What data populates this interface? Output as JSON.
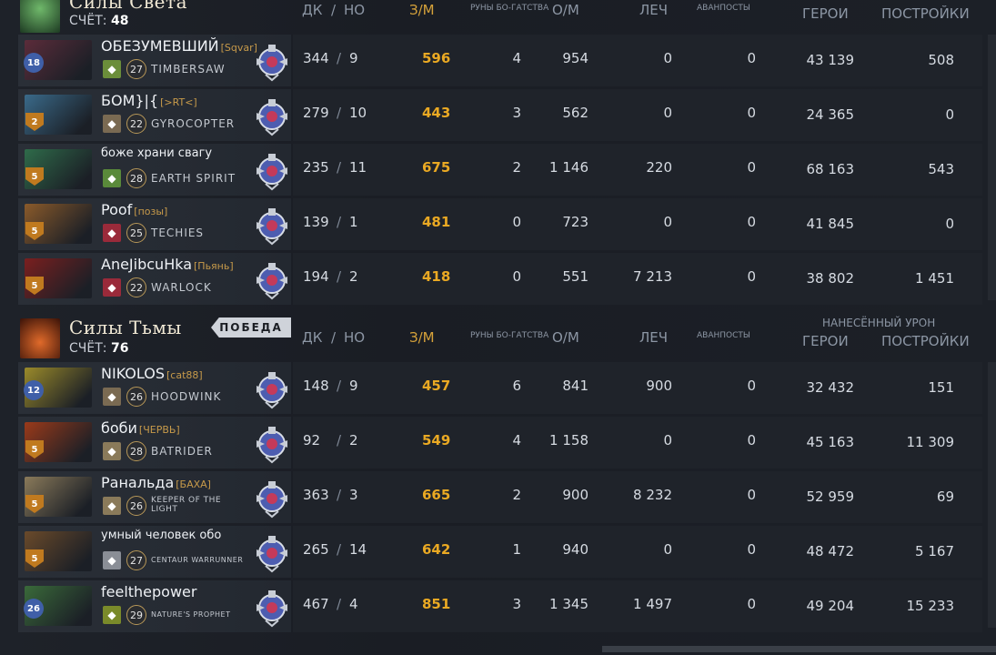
{
  "teams": [
    {
      "name": "Силы Света",
      "score_label": "СЧЁТ:",
      "score": "48",
      "colors": {
        "accent": "#66a35a"
      },
      "headers": {
        "kda_k": "ДК",
        "kda_sep": "/",
        "kda_d": "НО",
        "nw": "З/М",
        "runes": "РУНЫ БО-ГАТСТВА",
        "xpm": "О/М",
        "heal": "ЛЕЧ",
        "outposts": "АВАНПОСТЫ",
        "heroes": "ГЕРОИ",
        "buildings": "ПОСТРОЙКИ",
        "damage_group": ""
      },
      "players": [
        {
          "name": "ОБЕЗУМЕВШИЙ",
          "guild": "[Sqvar]",
          "hero": "TIMBERSAW",
          "hero_level": "18",
          "player_level": "27",
          "k": "344",
          "d": "9",
          "nw": "596",
          "runes": "4",
          "xpm": "954",
          "heal": "0",
          "outposts": "0",
          "hero_dmg": "43 139",
          "bld_dmg": "508",
          "hero_color": "#5b2c3a",
          "talent_color": "#6b8e3a",
          "talent_icon": "tree-icon"
        },
        {
          "name": "БОМ}|{",
          "guild": "[>RT<]",
          "hero": "GYROCOPTER",
          "hero_level": "2",
          "player_level": "22",
          "k": "279",
          "d": "10",
          "nw": "443",
          "runes": "3",
          "xpm": "562",
          "heal": "0",
          "outposts": "0",
          "hero_dmg": "24 365",
          "bld_dmg": "0",
          "hero_color": "#3a6a8a",
          "talent_color": "#7a6a52",
          "talent_icon": "wing-icon"
        },
        {
          "name": "боже храни свагу",
          "guild": "",
          "hero": "EARTH SPIRIT",
          "hero_level": "5",
          "player_level": "28",
          "k": "235",
          "d": "11",
          "nw": "675",
          "runes": "2",
          "xpm": "1 146",
          "heal": "220",
          "outposts": "0",
          "hero_dmg": "68 163",
          "bld_dmg": "543",
          "hero_color": "#2f6b4a",
          "talent_color": "#5a8a3a",
          "talent_icon": "leaf-icon"
        },
        {
          "name": "Poof",
          "guild": "[позы]",
          "hero": "TECHIES",
          "hero_level": "5",
          "player_level": "25",
          "k": "139",
          "d": "1",
          "nw": "481",
          "runes": "0",
          "xpm": "723",
          "heal": "0",
          "outposts": "0",
          "hero_dmg": "41 845",
          "bld_dmg": "0",
          "hero_color": "#8a5a2a",
          "talent_color": "#9a2a3a",
          "talent_icon": "claw-icon"
        },
        {
          "name": "AneJibcuHka",
          "guild": "[Пьянь]",
          "hero": "WARLOCK",
          "hero_level": "5",
          "player_level": "22",
          "k": "194",
          "d": "2",
          "nw": "418",
          "runes": "0",
          "xpm": "551",
          "heal": "7 213",
          "outposts": "0",
          "hero_dmg": "38 802",
          "bld_dmg": "1 451",
          "hero_color": "#7a1f1f",
          "talent_color": "#9a2a3a",
          "talent_icon": "castle-icon"
        }
      ]
    },
    {
      "name": "Силы Тьмы",
      "score_label": "СЧЁТ:",
      "score": "76",
      "victory": "ПОБЕДА",
      "colors": {
        "accent": "#b5481f"
      },
      "headers": {
        "kda_k": "ДК",
        "kda_sep": "/",
        "kda_d": "НО",
        "nw": "З/М",
        "runes": "РУНЫ БО-ГАТСТВА",
        "xpm": "О/М",
        "heal": "ЛЕЧ",
        "outposts": "АВАНПОСТЫ",
        "heroes": "ГЕРОИ",
        "buildings": "ПОСТРОЙКИ",
        "damage_group": "НАНЕСЁННЫЙ УРОН"
      },
      "players": [
        {
          "name": "NIKOLOS",
          "guild": "[cat88]",
          "hero": "HOODWINK",
          "hero_level": "12",
          "player_level": "26",
          "k": "148",
          "d": "9",
          "nw": "457",
          "runes": "6",
          "xpm": "841",
          "heal": "900",
          "outposts": "0",
          "hero_dmg": "32 432",
          "bld_dmg": "151",
          "hero_color": "#9a8a2a",
          "talent_color": "#7a6a52",
          "talent_icon": "hourglass-icon"
        },
        {
          "name": "боби",
          "guild": "[ЧЕРВЬ]",
          "hero": "BATRIDER",
          "hero_level": "5",
          "player_level": "28",
          "k": "92",
          "d": "2",
          "nw": "549",
          "runes": "4",
          "xpm": "1 158",
          "heal": "0",
          "outposts": "0",
          "hero_dmg": "45 163",
          "bld_dmg": "11 309",
          "hero_color": "#9a3a1a",
          "talent_color": "#8a7a5a",
          "talent_icon": "sword-icon"
        },
        {
          "name": "Ранальда",
          "guild": "[БАХА]",
          "hero": "KEEPER OF THE LIGHT",
          "hero_level": "5",
          "player_level": "26",
          "k": "363",
          "d": "3",
          "nw": "665",
          "runes": "2",
          "xpm": "900",
          "heal": "8 232",
          "outposts": "0",
          "hero_dmg": "52 959",
          "bld_dmg": "69",
          "hero_color": "#8a7a5a",
          "talent_color": "#8a7a5a",
          "talent_icon": "boot-icon"
        },
        {
          "name": "умный человек обо",
          "guild": "",
          "hero": "CENTAUR WARRUNNER",
          "hero_level": "5",
          "player_level": "27",
          "k": "265",
          "d": "14",
          "nw": "642",
          "runes": "1",
          "xpm": "940",
          "heal": "0",
          "outposts": "0",
          "hero_dmg": "48 472",
          "bld_dmg": "5 167",
          "hero_color": "#6a4a2a",
          "talent_color": "#8a8e96",
          "talent_icon": "wing-icon"
        },
        {
          "name": "feelthepower",
          "guild": "",
          "hero": "NATURE'S PROPHET",
          "hero_level": "26",
          "player_level": "29",
          "k": "467",
          "d": "4",
          "nw": "851",
          "runes": "3",
          "xpm": "1 345",
          "heal": "1 497",
          "outposts": "0",
          "hero_dmg": "49 204",
          "bld_dmg": "15 233",
          "hero_color": "#3a6a3a",
          "talent_color": "#7a8a2a",
          "talent_icon": "mask-icon"
        }
      ]
    }
  ]
}
